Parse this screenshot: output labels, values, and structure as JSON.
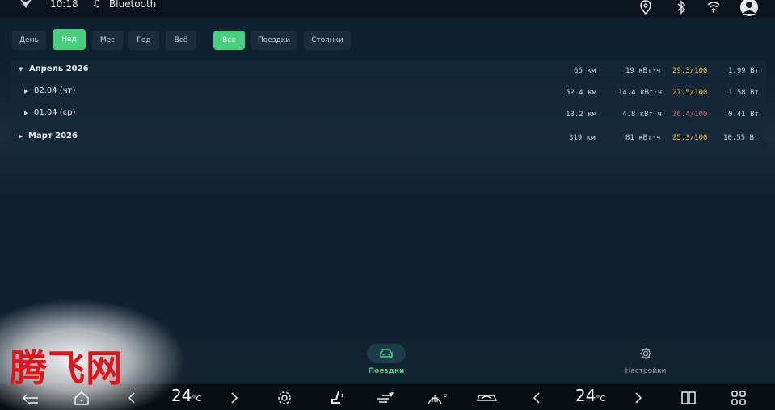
{
  "status_bar": {
    "time": "10:18",
    "bluetooth_label": "Bluetooth",
    "icons": [
      "music-note-icon",
      "location-icon",
      "bluetooth-icon",
      "wifi-icon",
      "user-avatar-icon"
    ]
  },
  "period_filters": [
    {
      "label": "День",
      "active": false
    },
    {
      "label": "Нед",
      "active": true
    },
    {
      "label": "Мес",
      "active": false
    },
    {
      "label": "Год",
      "active": false
    },
    {
      "label": "Всё",
      "active": false
    }
  ],
  "type_filters": [
    {
      "label": "Все",
      "active": true
    },
    {
      "label": "Поездки",
      "active": false
    },
    {
      "label": "Стоянки",
      "active": false
    }
  ],
  "rows": [
    {
      "label": "Апрель 2026",
      "expanded": true,
      "bold": true,
      "distance": "66 км",
      "energy": "19 кВт·ч",
      "consumption": "29.3/100",
      "cost": "1.99 Вт",
      "consumption_level": "normal"
    },
    {
      "label": "02.04 (чт)",
      "expanded": false,
      "bold": false,
      "distance": "52.4 км",
      "energy": "14.4 кВт·ч",
      "consumption": "27.5/100",
      "cost": "1.58 Вт",
      "consumption_level": "normal"
    },
    {
      "label": "01.04 (ср)",
      "expanded": false,
      "bold": false,
      "distance": "13.2 км",
      "energy": "4.8 кВт·ч",
      "consumption": "36.4/100",
      "cost": "0.41 Вт",
      "consumption_level": "high"
    },
    {
      "label": "Март 2026",
      "expanded": false,
      "bold": true,
      "distance": "319 км",
      "energy": "81 кВт·ч",
      "consumption": "25.3/100",
      "cost": "10.55 Вт",
      "consumption_level": "normal"
    }
  ],
  "app_nav": {
    "trips_label": "Поездки",
    "settings_label": "Настройки"
  },
  "car_bar": {
    "temp_left": "24",
    "temp_right": "24",
    "temp_unit": "°C",
    "defrost_label": "F"
  },
  "watermark": "腾飞网",
  "colors": {
    "accent": "#48cf7e",
    "consumption_normal": "#f1c232",
    "consumption_high": "#e36262",
    "panel": "#0f2030"
  }
}
